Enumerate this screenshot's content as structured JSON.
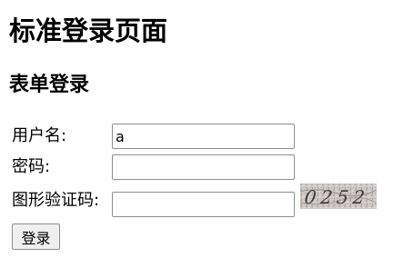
{
  "page": {
    "title": "标准登录页面",
    "subtitle": "表单登录"
  },
  "form": {
    "username_label": "用户名:",
    "username_value": "a",
    "password_label": "密码:",
    "password_value": "",
    "captcha_label": "图形验证码:",
    "captcha_value": "",
    "captcha_text": "0252",
    "submit_label": "登录"
  }
}
